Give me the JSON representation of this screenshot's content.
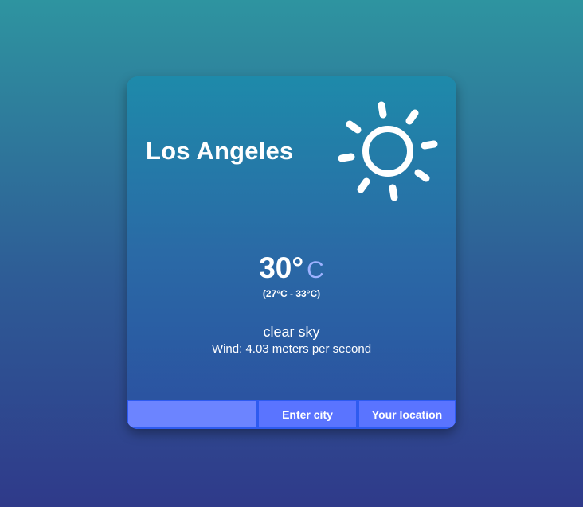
{
  "weather": {
    "city": "Los Angeles",
    "icon": "sun-icon",
    "temperature": "30°",
    "unit": "C",
    "range": "(27°C - 33°C)",
    "description": "clear sky",
    "wind": "Wind: 4.03 meters per second"
  },
  "controls": {
    "city_input_value": "",
    "city_input_placeholder": "",
    "enter_city_label": "Enter city",
    "your_location_label": "Your location"
  },
  "colors": {
    "unit_accent": "#9db2ff",
    "input_bg": "#6c84ff",
    "button_bg": "#5a74ff",
    "border": "#2e5bf0"
  }
}
